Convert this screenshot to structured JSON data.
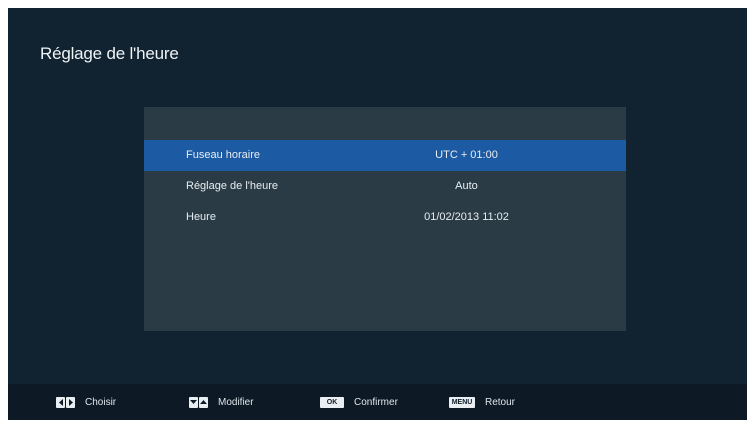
{
  "title": "Réglage de l'heure",
  "settings": [
    {
      "label": "Fuseau horaire",
      "value": "UTC + 01:00"
    },
    {
      "label": "Réglage de l'heure",
      "value": "Auto"
    },
    {
      "label": "Heure",
      "value": "01/02/2013 11:02"
    }
  ],
  "selected_index": 0,
  "footer": {
    "choose_label": "Choisir",
    "modify_label": "Modifier",
    "ok_key": "OK",
    "confirm_label": "Confirmer",
    "menu_key": "MENU",
    "back_label": "Retour"
  },
  "colors": {
    "background": "#112230",
    "panel": "#2b3b45",
    "selection": "#1d5aa4",
    "footer": "#0d1924"
  }
}
